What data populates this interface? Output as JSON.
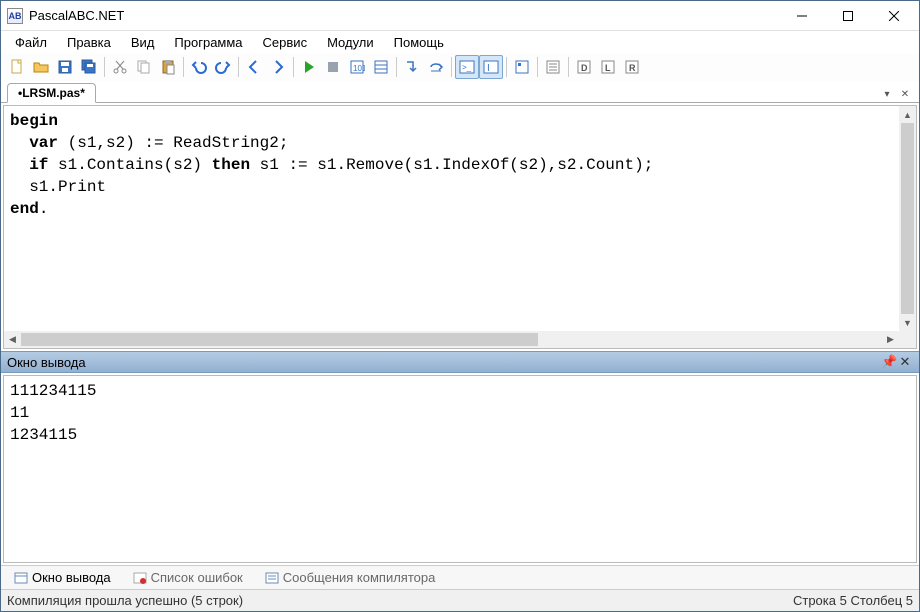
{
  "window": {
    "title": "PascalABC.NET",
    "app_icon_text": "AB"
  },
  "menu": {
    "items": [
      "Файл",
      "Правка",
      "Вид",
      "Программа",
      "Сервис",
      "Модули",
      "Помощь"
    ]
  },
  "tabs": {
    "active": "•LRSM.pas*"
  },
  "editor": {
    "tokens": [
      {
        "t": "begin",
        "kw": true
      },
      {
        "t": "\n"
      },
      {
        "t": "  "
      },
      {
        "t": "var",
        "kw": true
      },
      {
        "t": " (s1,s2) := ReadString2;\n"
      },
      {
        "t": "  "
      },
      {
        "t": "if",
        "kw": true
      },
      {
        "t": " s1.Contains(s2) "
      },
      {
        "t": "then",
        "kw": true
      },
      {
        "t": " s1 := s1.Remove(s1.IndexOf(s2),s2.Count);\n"
      },
      {
        "t": "  s1.Print\n"
      },
      {
        "t": "end",
        "kw": true
      },
      {
        "t": "."
      }
    ]
  },
  "output": {
    "title": "Окно вывода",
    "text": "111234115\n11\n1234115"
  },
  "bottom_tabs": {
    "items": [
      {
        "label": "Окно вывода",
        "active": true
      },
      {
        "label": "Список ошибок",
        "active": false
      },
      {
        "label": "Сообщения компилятора",
        "active": false
      }
    ]
  },
  "status": {
    "left": "Компиляция прошла успешно (5 строк)",
    "right": "Строка  5  Столбец  5"
  }
}
